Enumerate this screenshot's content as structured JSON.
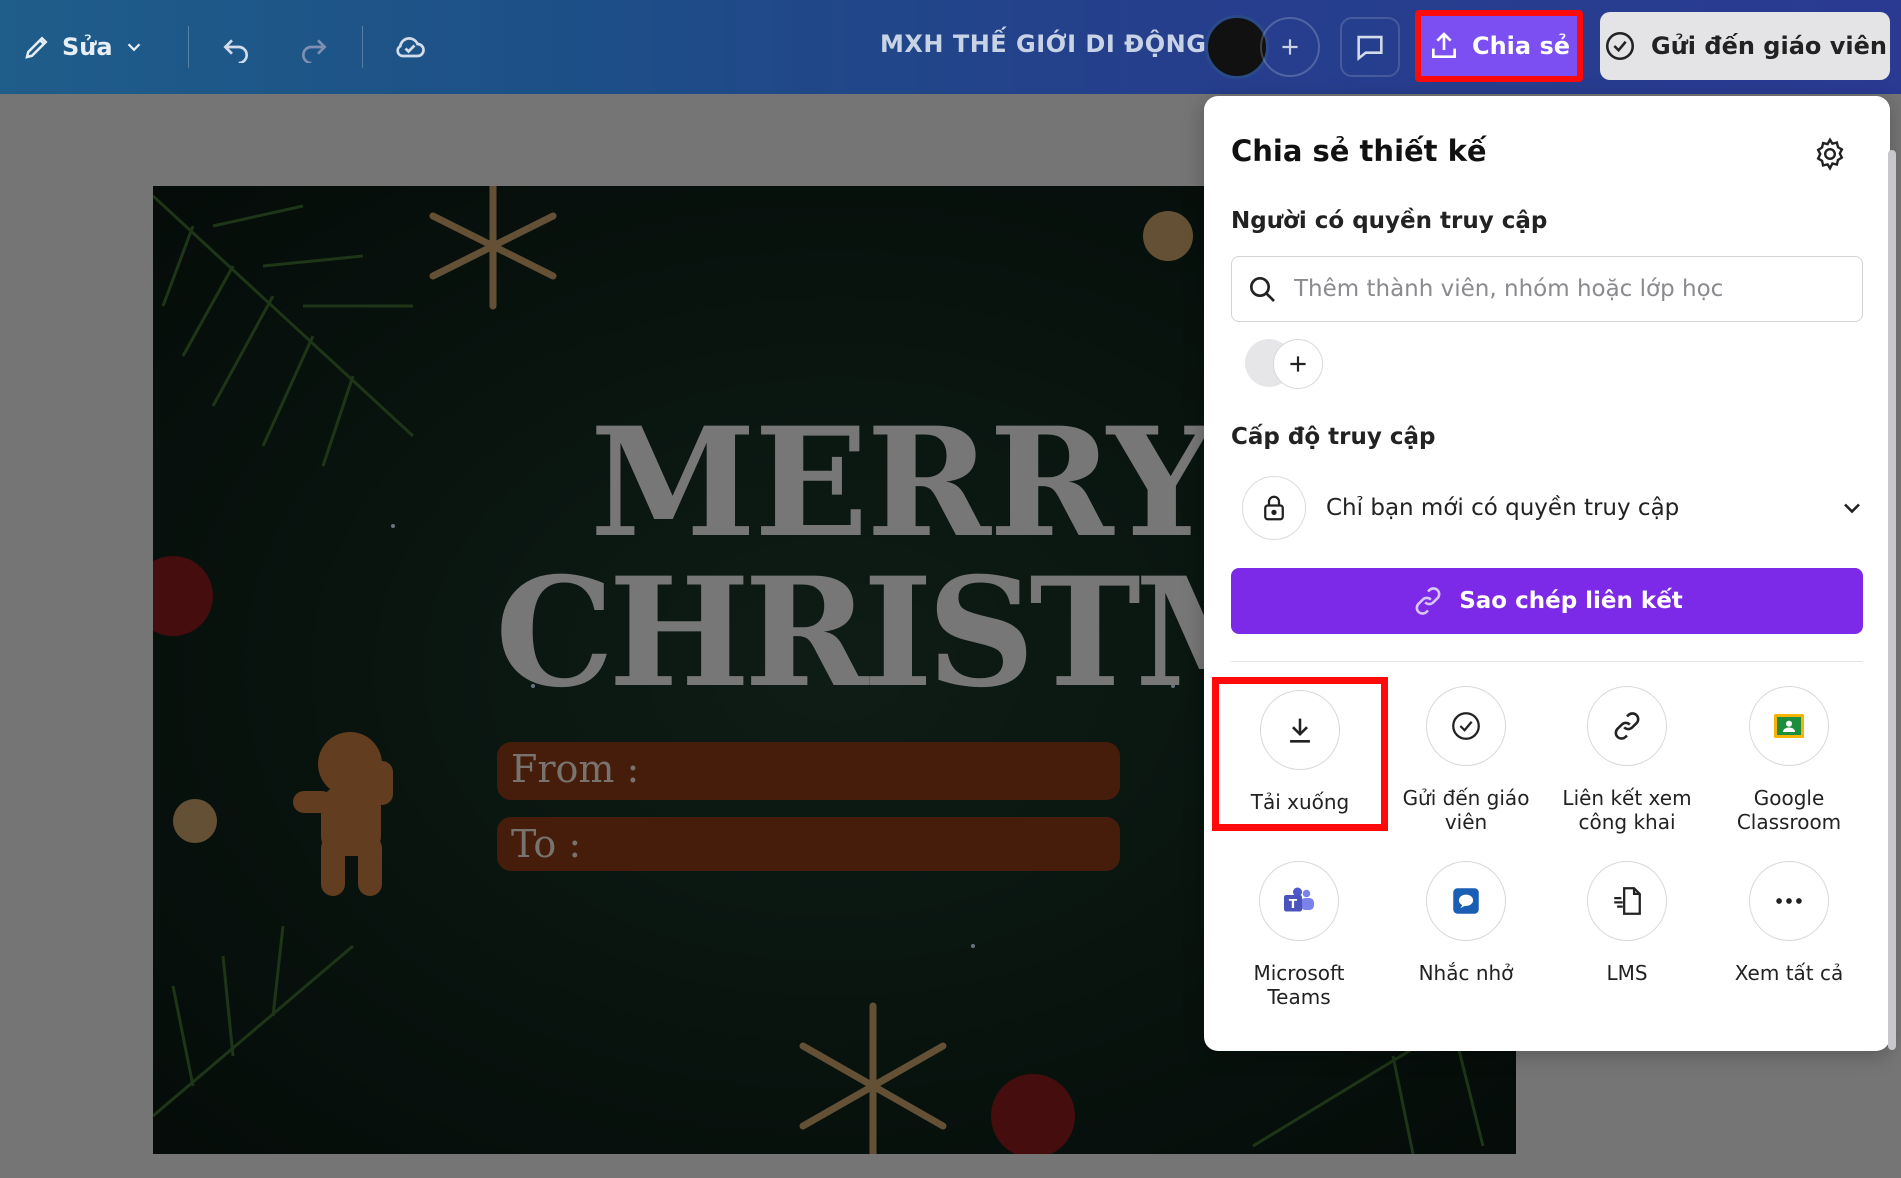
{
  "toolbar": {
    "edit_label": "Sửa",
    "doc_title": "MXH THẾ GIỚI DI ĐỘNG",
    "share_label": "Chia sẻ",
    "send_teacher_label": "Gửi đến giáo viên"
  },
  "design": {
    "line1": "MERRY",
    "line2": "CHRISTMAS",
    "from_label": "From :",
    "to_label": "To :"
  },
  "share_panel": {
    "title": "Chia sẻ thiết kế",
    "people_label": "Người có quyền truy cập",
    "search_placeholder": "Thêm thành viên, nhóm hoặc lớp học",
    "access_level_label": "Cấp độ truy cập",
    "access_value": "Chỉ bạn mới có quyền truy cập",
    "copy_link_label": "Sao chép liên kết",
    "options": [
      {
        "label": "Tải xuống",
        "icon": "download-icon"
      },
      {
        "label": "Gửi đến giáo viên",
        "icon": "check-circle-icon"
      },
      {
        "label": "Liên kết xem công khai",
        "icon": "link-icon"
      },
      {
        "label": "Google Classroom",
        "icon": "google-classroom-icon"
      },
      {
        "label": "Microsoft Teams",
        "icon": "microsoft-teams-icon"
      },
      {
        "label": "Nhắc nhở",
        "icon": "reminder-icon"
      },
      {
        "label": "LMS",
        "icon": "lms-icon"
      },
      {
        "label": "Xem tất cả",
        "icon": "more-icon"
      }
    ]
  },
  "colors": {
    "share_button": "#7b4ff2",
    "copy_button": "#7d2ae8",
    "highlight": "#ff0a0a"
  }
}
